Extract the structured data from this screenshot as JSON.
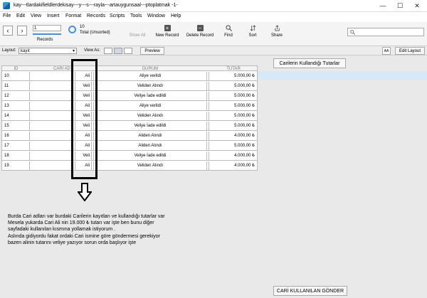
{
  "window": {
    "title": "kay---tlardakifieldlerdekisay---y---s---rayla---artauygunsaal---ptoplatmak -1-",
    "minimize": "—",
    "maximize": "☐",
    "close": "✕"
  },
  "menu": [
    "File",
    "Edit",
    "View",
    "Insert",
    "Format",
    "Records",
    "Scripts",
    "Tools",
    "Window",
    "Help"
  ],
  "toolbar": {
    "prev": "‹",
    "next": "›",
    "record_value": "1",
    "records_label": "Records",
    "total_count": "10",
    "total_label": "Total (Unsorted)",
    "show_all": "Show All",
    "new_record": "New Record",
    "delete_record": "Delete Record",
    "find": "Find",
    "sort": "Sort",
    "share": "Share",
    "search_placeholder": ""
  },
  "layoutbar": {
    "layout_label": "Layout:",
    "layout_value": "kayıt",
    "view_as_label": "View As:",
    "preview": "Preview",
    "aa": "AA",
    "edit_layout": "Edit Layout"
  },
  "table": {
    "headers": [
      "ID",
      "CARI AD",
      "DURUM",
      "TUTAR"
    ],
    "rows": [
      {
        "id": "10",
        "ad": "Ali",
        "durum": "Aliye verildi",
        "tutar": "5.000,00 ₺"
      },
      {
        "id": "11",
        "ad": "Veli",
        "durum": "Veliden Alındı",
        "tutar": "5.000,00 ₺"
      },
      {
        "id": "12",
        "ad": "Veli",
        "durum": "Veliye İade edildi",
        "tutar": "5.000,00 ₺"
      },
      {
        "id": "13",
        "ad": "Ali",
        "durum": "Aliye verildi",
        "tutar": "5.000,00 ₺"
      },
      {
        "id": "14",
        "ad": "Veli",
        "durum": "Veliden Alındı",
        "tutar": "5.000,00 ₺"
      },
      {
        "id": "15",
        "ad": "Veli",
        "durum": "Veliye İade edildi",
        "tutar": "5.000,00 ₺"
      },
      {
        "id": "16",
        "ad": "Ali",
        "durum": "Aliden Alındı",
        "tutar": "4.000,00 ₺"
      },
      {
        "id": "17",
        "ad": "Ali",
        "durum": "Aliden Alındı",
        "tutar": "5.000,00 ₺"
      },
      {
        "id": "18",
        "ad": "Veli",
        "durum": "Veliye İade edildi",
        "tutar": "4.000,00 ₺"
      },
      {
        "id": "19",
        "ad": "Ali",
        "durum": "Veliden Alındı",
        "tutar": "4.000,00 ₺"
      }
    ]
  },
  "buttons": {
    "tutarlar": "Carilerin Kullandığı Tutarlar",
    "gonder": "CARİ KULLANILAN GÖNDER"
  },
  "note": [
    "Burda Cari adları var burdaki Carilerin kayıtları ve kullandığı tutarlar var",
    "Mesela yukarda Cari Ali nin  19.000 ₺ tutarı var işte ben bunu diğer",
    "sayfadaki kullanılan kısmına yollamak istiyorum .",
    "Aslında gidiyordu fakat ordaki Cari ismine göre göndermesi gerekiyor",
    "bazen alinin tutarını veliye yazıyor sorun orda başlıyor işte"
  ]
}
